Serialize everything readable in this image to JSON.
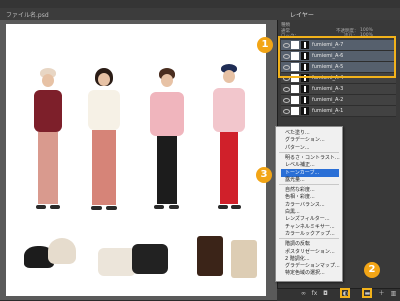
{
  "app": {
    "doc_tab": "ファイル名.psd",
    "panel_title": "レイヤー",
    "panel_controls": {
      "kind": "種類",
      "mode": "通常",
      "opacity_label": "不透明度：",
      "opacity_value": "100%",
      "lock_label": "ロック：",
      "fill_label": "塗り：",
      "fill_value": "100%"
    }
  },
  "layers": [
    {
      "name": "fumiemi_A-7",
      "selected": true
    },
    {
      "name": "fumiemi_A-6",
      "selected": true
    },
    {
      "name": "fumiemi_A-5",
      "selected": true
    },
    {
      "name": "fumiemi_A-4",
      "selected": false
    },
    {
      "name": "fumiemi_A-3",
      "selected": false
    },
    {
      "name": "fumiemi_A-2",
      "selected": false
    },
    {
      "name": "fumiemi_A-1",
      "selected": false
    }
  ],
  "badges": {
    "one": "1",
    "two": "2",
    "three": "3"
  },
  "menu": {
    "items": [
      "べた塗り...",
      "グラデーション...",
      "パターン...",
      "明るさ・コントラスト...",
      "レベル補正...",
      "トーンカーブ...",
      "露光量...",
      "自然な彩度...",
      "色相・彩度...",
      "カラーバランス...",
      "白黒...",
      "レンズフィルター...",
      "チャンネルミキサー...",
      "カラールックアップ...",
      "階調の反転",
      "ポスタリゼーション...",
      "2 階調化...",
      "グラデーションマップ...",
      "特定色域の選択..."
    ],
    "highlighted_index": 5
  },
  "bottom_icons": [
    "link-icon",
    "fx-icon",
    "mask-icon",
    "adjustment-icon",
    "group-icon",
    "new-layer-icon",
    "trash-icon"
  ],
  "colors": {
    "accent": "#f2a516",
    "menu_highlight": "#2a6fd6"
  }
}
